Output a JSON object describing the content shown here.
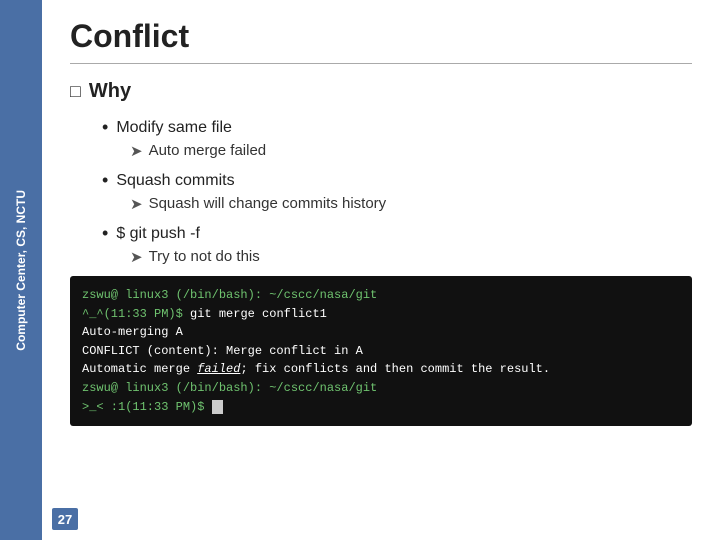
{
  "sidebar": {
    "text": "Computer Center, CS, NCTU"
  },
  "page": {
    "title": "Conflict",
    "page_number": "27"
  },
  "why": {
    "label": "Why"
  },
  "bullets": [
    {
      "main": "Modify same file",
      "sub": [
        {
          "text": "Auto merge failed"
        }
      ]
    },
    {
      "main": "Squash commits",
      "sub": [
        {
          "text": "Squash will change commits history"
        }
      ]
    },
    {
      "main": "$ git push -f",
      "sub": [
        {
          "text": "Try to not do this"
        }
      ]
    }
  ],
  "terminal": {
    "lines": [
      {
        "type": "prompt",
        "prompt": "zswu@ linux3 (/bin/bash): ~/cscc/nasa/git",
        "cmd": ""
      },
      {
        "type": "cmd",
        "prompt": "^_^(11:33 PM)$ ",
        "cmd": "git merge conflict1"
      },
      {
        "type": "auto",
        "text": "Auto-merging A"
      },
      {
        "type": "conflict",
        "text": "CONFLICT (content): Merge conflict in A"
      },
      {
        "type": "failed",
        "before": "Automatic merge ",
        "highlight": "failed",
        "after": "; fix conflicts and then commit the result."
      },
      {
        "type": "prompt2",
        "prompt": "zswu@ linux3 (/bin/bash): ~/cscc/nasa/git",
        "cmd": ""
      },
      {
        "type": "cursor",
        "prompt": ">_< :1(11:33 PM)$ ",
        "cursor": " "
      }
    ]
  }
}
